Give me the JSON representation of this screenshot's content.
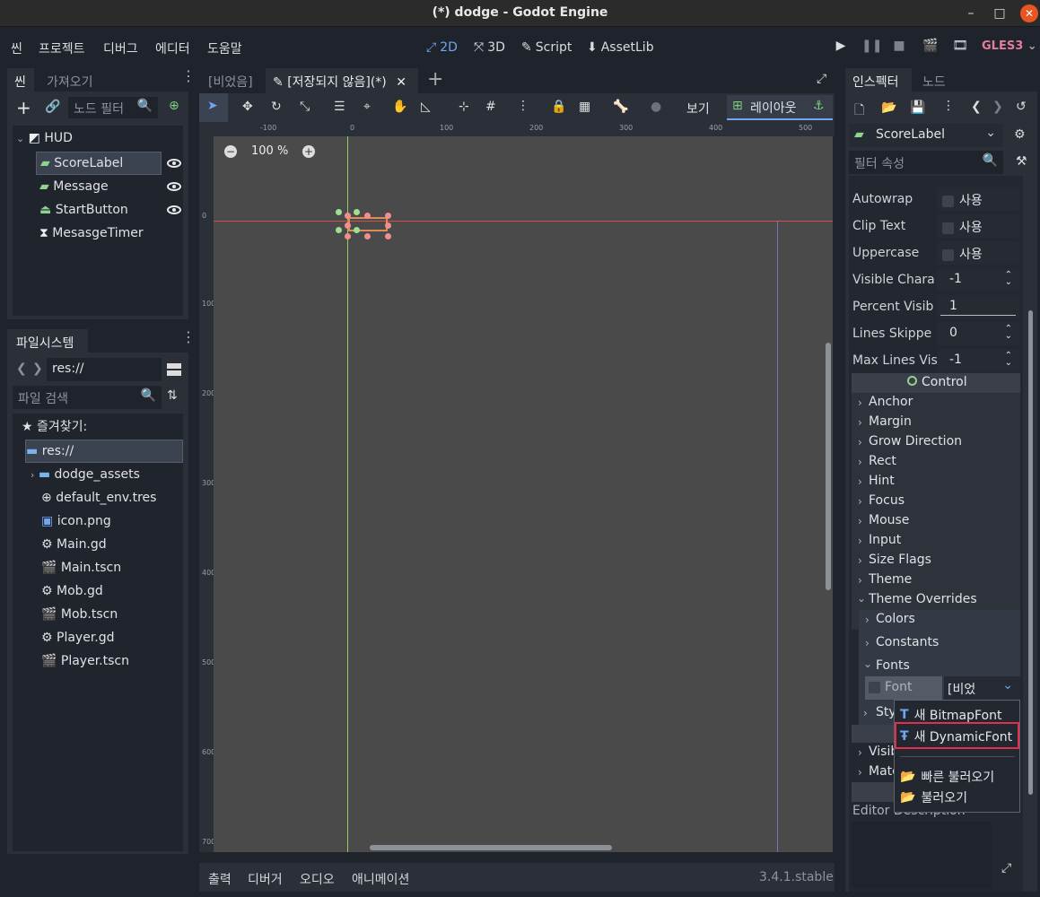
{
  "window": {
    "title": "(*) dodge - Godot Engine"
  },
  "menu": {
    "items": [
      "씬",
      "프로젝트",
      "디버그",
      "에디터",
      "도움말"
    ]
  },
  "workspaces": {
    "btn_2d": "2D",
    "btn_3d": "3D",
    "btn_script": "Script",
    "btn_assetlib": "AssetLib"
  },
  "renderer": {
    "label": "GLES3"
  },
  "scene_dock": {
    "tabs": [
      "씬",
      "가져오기"
    ],
    "filter_placeholder": "노드 필터",
    "nodes": [
      {
        "label": "HUD",
        "icon": "control-icon"
      },
      {
        "label": "ScoreLabel",
        "icon": "label-icon"
      },
      {
        "label": "Message",
        "icon": "label-icon"
      },
      {
        "label": "StartButton",
        "icon": "button-icon"
      },
      {
        "label": "MesasgeTimer",
        "icon": "timer-icon"
      }
    ]
  },
  "filesystem": {
    "tab": "파일시스템",
    "path": "res://",
    "search_placeholder": "파일 검색",
    "favorites": "즐겨찾기:",
    "root": "res://",
    "items": [
      "dodge_assets",
      "default_env.tres",
      "icon.png",
      "Main.gd",
      "Main.tscn",
      "Mob.gd",
      "Mob.tscn",
      "Player.gd",
      "Player.tscn"
    ]
  },
  "editor_tabs": [
    "[비었음]",
    "[저장되지 않음](*)"
  ],
  "toolbar": {
    "view": "보기",
    "layout": "레이아웃"
  },
  "viewport": {
    "zoom": "100 %",
    "ruler_h": [
      "-100",
      "0",
      "100",
      "200",
      "300",
      "400",
      "500"
    ],
    "ruler_v": [
      "0",
      "100",
      "200",
      "300",
      "400",
      "500",
      "600",
      "700"
    ]
  },
  "bottom_panel": {
    "tabs": [
      "출력",
      "디버거",
      "오디오",
      "애니메이션"
    ],
    "version": "3.4.1.stable"
  },
  "inspector": {
    "tabs": [
      "인스펙터",
      "노드"
    ],
    "node_name": "ScoreLabel",
    "filter_placeholder": "필터 속성",
    "props": [
      {
        "label": "Autowrap",
        "value": "사용",
        "kind": "check"
      },
      {
        "label": "Clip Text",
        "value": "사용",
        "kind": "check"
      },
      {
        "label": "Uppercase",
        "value": "사용",
        "kind": "check"
      },
      {
        "label": "Visible Chara",
        "value": "-1",
        "kind": "spin"
      },
      {
        "label": "Percent Visib",
        "value": "1",
        "kind": "slider"
      },
      {
        "label": "Lines Skippe",
        "value": "0",
        "kind": "spin"
      },
      {
        "label": "Max Lines Vis",
        "value": "-1",
        "kind": "spin"
      }
    ],
    "control_header": "Control",
    "sections": [
      "Anchor",
      "Margin",
      "Grow Direction",
      "Rect",
      "Hint",
      "Focus",
      "Mouse",
      "Input",
      "Size Flags",
      "Theme",
      "Theme Overrides"
    ],
    "overrides": [
      "Colors",
      "Constants",
      "Fonts"
    ],
    "font_prop": {
      "label": "Font",
      "value": "[비었"
    },
    "styles_partial": "Sty",
    "visib_partial": "Visib",
    "mate_partial": "Mate",
    "editor_description": "Editor Description"
  },
  "popup": {
    "items": [
      "새 BitmapFont",
      "새 DynamicFont",
      "빠른 불러오기",
      "불러오기"
    ],
    "highlight_color": "#e0304e"
  }
}
